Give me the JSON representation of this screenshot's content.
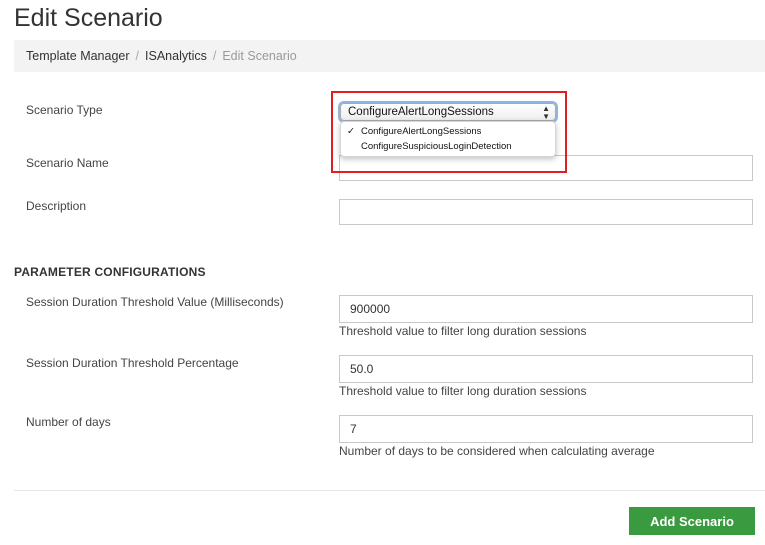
{
  "page": {
    "title": "Edit Scenario"
  },
  "breadcrumb": {
    "items": [
      "Template Manager",
      "ISAnalytics"
    ],
    "current": "Edit Scenario",
    "separator": "/"
  },
  "scenario_type": {
    "label": "Scenario Type",
    "selected": "ConfigureAlertLongSessions",
    "options": [
      "ConfigureAlertLongSessions",
      "ConfigureSuspiciousLoginDetection"
    ],
    "check_mark": "✓"
  },
  "scenario_name": {
    "label": "Scenario Name",
    "value": ""
  },
  "description": {
    "label": "Description",
    "value": ""
  },
  "parameters": {
    "title": "PARAMETER CONFIGURATIONS",
    "duration_value": {
      "label": "Session Duration Threshold Value (Milliseconds)",
      "value": "900000",
      "help": "Threshold value to filter long duration sessions"
    },
    "duration_percentage": {
      "label": "Session Duration Threshold Percentage",
      "value": "50.0",
      "help": "Threshold value to filter long duration sessions"
    },
    "days": {
      "label": "Number of days",
      "value": "7",
      "help": "Number of days to be considered when calculating average"
    }
  },
  "actions": {
    "add_label": "Add Scenario"
  },
  "colors": {
    "add_button": "#3a9a3f",
    "highlight": "#e02020"
  }
}
